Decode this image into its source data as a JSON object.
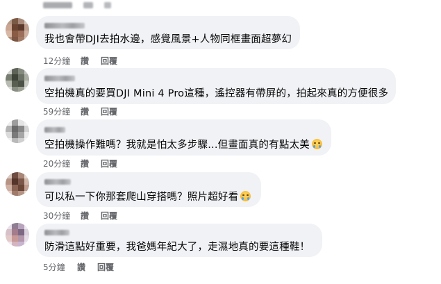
{
  "comments": [
    {
      "text": "我也會帶DJI去拍水邊，感覺風景+人物同框畫面超夢幻",
      "emoji": null,
      "time": "12分鐘",
      "like": "讚",
      "reply": "回覆"
    },
    {
      "text": "空拍機真的要買DJI Mini 4 Pro這種，遙控器有帶屏的，拍起來真的方便很多",
      "emoji": null,
      "time": "59分鐘",
      "like": "讚",
      "reply": "回覆"
    },
    {
      "text": "空拍機操作難嗎？我就是怕太多步驟...但畫面真的有點太美",
      "emoji": "face-holding-back-tears-icon",
      "time": "20分鐘",
      "like": "讚",
      "reply": "回覆"
    },
    {
      "text": "可以私一下你那套爬山穿搭嗎？照片超好看",
      "emoji": "face-holding-back-tears-icon",
      "time": "30分鐘",
      "like": "讚",
      "reply": "回覆"
    },
    {
      "text": "防滑這點好重要，我爸媽年紀大了，走濕地真的要這種鞋！",
      "emoji": null,
      "time": "5分鐘",
      "like": "讚",
      "reply": "回覆"
    }
  ],
  "colors": {
    "bubble": "#f0f2f5",
    "text": "#050505",
    "meta": "#65676b",
    "background": "#ffffff"
  }
}
